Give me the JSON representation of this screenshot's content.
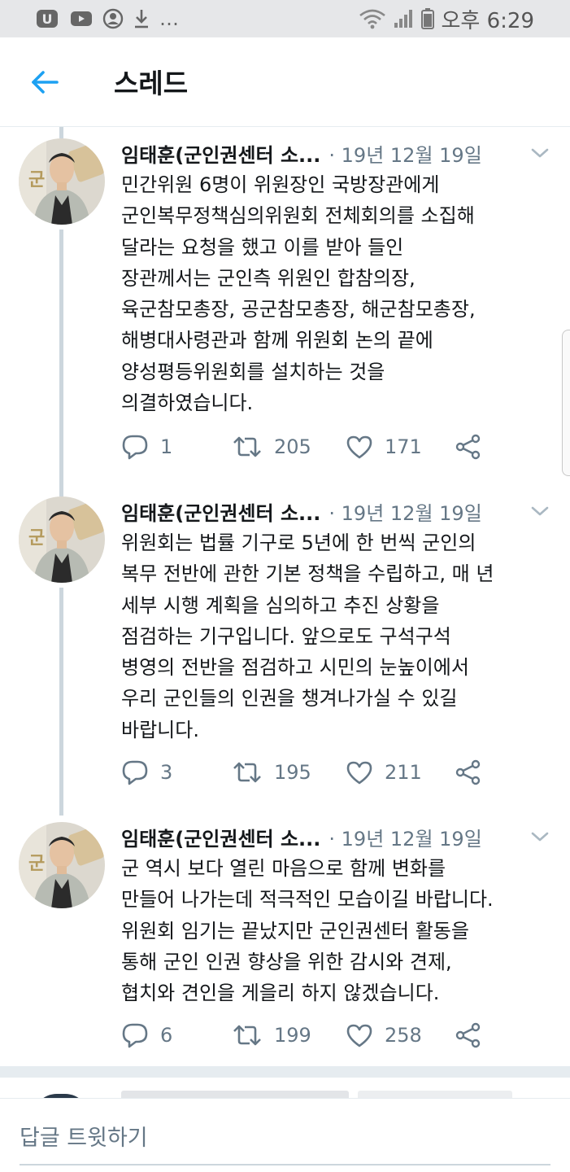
{
  "status_bar": {
    "time": "오후 6:29",
    "icons": [
      "u-plus-icon",
      "youtube-icon",
      "account-icon",
      "download-icon",
      "more-dots",
      "wifi-icon",
      "signal-icon",
      "battery-icon"
    ]
  },
  "header": {
    "back_label": "←",
    "title": "스레드"
  },
  "colors": {
    "accent": "#1da1f2",
    "text": "#14171a",
    "secondary": "#657786",
    "divider": "#e6ecf0"
  },
  "tweets": [
    {
      "author": "임태훈(군인권센터 소...",
      "meta": "· 19년 12월 19일",
      "lines": [
        "민간위원 6명이 위원장인 국방장관에게",
        "군인복무정책심의위원회 전체회의를 소집해",
        "달라는 요청을 했고 이를 받아 들인",
        "장관께서는 군인측 위원인 합참의장,",
        "육군참모총장, 공군참모총장, 해군참모총장,",
        "해병대사령관과 함께 위원회 논의 끝에",
        "양성평등위원회를 설치하는 것을",
        "의결하였습니다."
      ],
      "replies": "1",
      "retweets": "205",
      "likes": "171"
    },
    {
      "author": "임태훈(군인권센터 소...",
      "meta": "· 19년 12월 19일",
      "lines": [
        "위원회는 법률 기구로 5년에 한 번씩 군인의",
        "복무 전반에 관한 기본 정책을 수립하고, 매 년",
        "세부 시행 계획을 심의하고 추진 상황을",
        "점검하는 기구입니다. 앞으로도 구석구석",
        "병영의 전반을 점검하고 시민의 눈높이에서",
        "우리 군인들의 인권을 챙겨나가실 수 있길",
        "바랍니다."
      ],
      "replies": "3",
      "retweets": "195",
      "likes": "211"
    },
    {
      "author": "임태훈(군인권센터 소...",
      "meta": "· 19년 12월 19일",
      "lines": [
        "군 역시 보다 열린 마음으로 함께 변화를",
        "만들어 나가는데 적극적인 모습이길 바랍니다.",
        "위원회 임기는 끝났지만 군인권센터 활동을",
        "통해 군인 인권 향상을 위한 감시와 견제,",
        "협치와 견인을 게을리 하지 않겠습니다."
      ],
      "replies": "6",
      "retweets": "199",
      "likes": "258"
    }
  ],
  "reply_bar": {
    "placeholder": "답글 트윗하기"
  }
}
